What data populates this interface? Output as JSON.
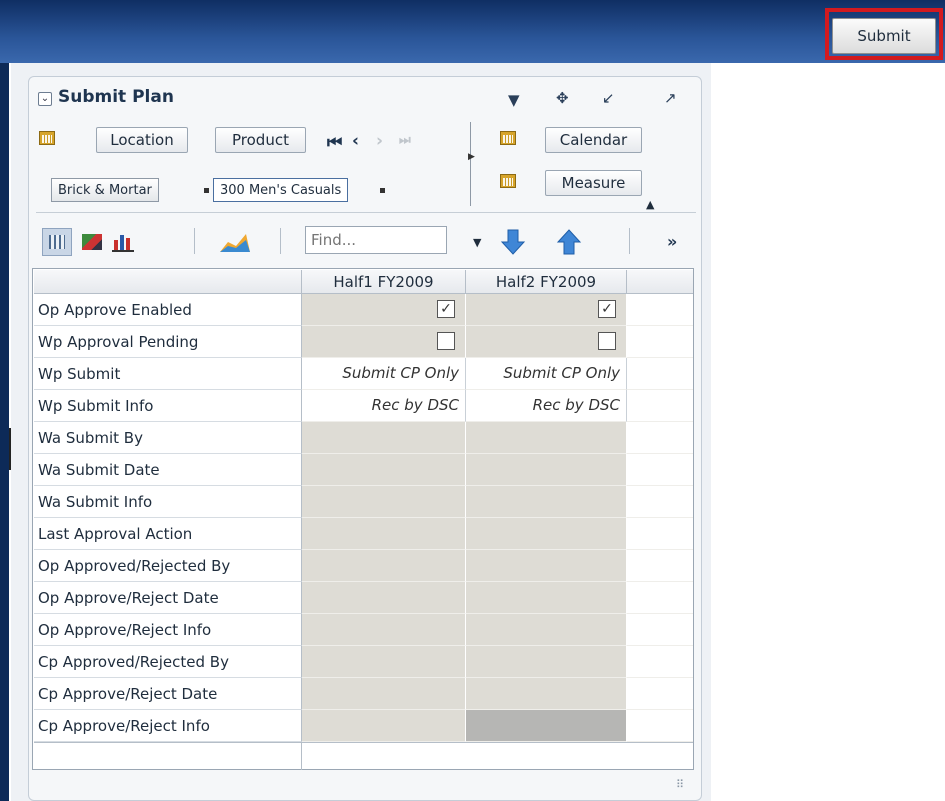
{
  "toolbar": {
    "submit_label": "Submit"
  },
  "panel": {
    "title": "Submit Plan",
    "icons": [
      "dropdown-icon",
      "move-icon",
      "restore-icon",
      "maximize-icon"
    ]
  },
  "dimensions": {
    "location_label": "Location",
    "product_label": "Product",
    "calendar_label": "Calendar",
    "measure_label": "Measure",
    "location_value": "Brick & Mortar",
    "product_value": "300 Men's Casuals"
  },
  "view_toolbar": {
    "find_placeholder": "Find...",
    "more_glyph": "»"
  },
  "table": {
    "columns": [
      "Half1 FY2009",
      "Half2 FY2009"
    ],
    "rows": [
      {
        "label": "Op Approve Enabled",
        "h1": "",
        "h2": "",
        "type": "checkbox",
        "h1_checked": true,
        "h2_checked": true
      },
      {
        "label": "Wp Approval Pending",
        "h1": "",
        "h2": "",
        "type": "checkbox",
        "h1_checked": false,
        "h2_checked": false
      },
      {
        "label": "Wp Submit",
        "h1": "Submit CP Only",
        "h2": "Submit CP Only",
        "type": "text"
      },
      {
        "label": "Wp Submit Info",
        "h1": "Rec by DSC",
        "h2": "Rec by DSC",
        "type": "text"
      },
      {
        "label": "Wa Submit By",
        "h1": "",
        "h2": "",
        "type": "grey"
      },
      {
        "label": "Wa Submit Date",
        "h1": "",
        "h2": "",
        "type": "grey"
      },
      {
        "label": "Wa Submit Info",
        "h1": "",
        "h2": "",
        "type": "grey"
      },
      {
        "label": "Last Approval Action",
        "h1": "",
        "h2": "",
        "type": "grey"
      },
      {
        "label": "Op Approved/Rejected By",
        "h1": "",
        "h2": "",
        "type": "grey"
      },
      {
        "label": "Op Approve/Reject Date",
        "h1": "",
        "h2": "",
        "type": "grey"
      },
      {
        "label": "Op Approve/Reject Info",
        "h1": "",
        "h2": "",
        "type": "grey"
      },
      {
        "label": "Cp Approved/Rejected By",
        "h1": "",
        "h2": "",
        "type": "grey"
      },
      {
        "label": "Cp Approve/Reject Date",
        "h1": "",
        "h2": "",
        "type": "grey"
      },
      {
        "label": "Cp Approve/Reject Info",
        "h1": "",
        "h2": "",
        "type": "greydark"
      }
    ]
  }
}
